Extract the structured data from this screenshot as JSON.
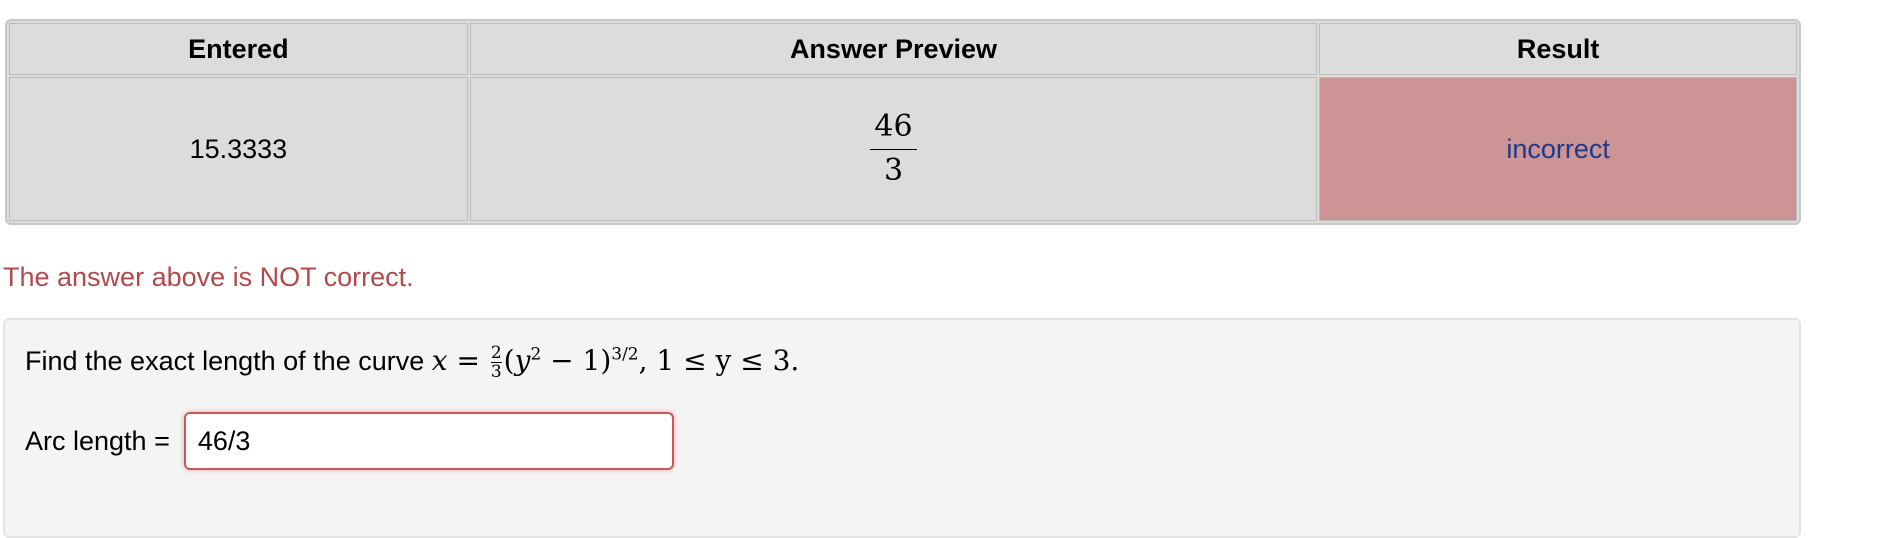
{
  "results_table": {
    "headers": {
      "entered": "Entered",
      "preview": "Answer Preview",
      "result": "Result"
    },
    "row": {
      "entered": "15.3333",
      "preview_numerator": "46",
      "preview_denominator": "3",
      "result": "incorrect"
    },
    "colors": {
      "header_bg": "#dcdcdc",
      "incorrect_bg": "#cc9494",
      "incorrect_text": "#1c3a8c"
    }
  },
  "feedback": {
    "message": "The answer above is NOT correct.",
    "color": "#b14a4a"
  },
  "problem": {
    "intro": "Find the exact length of the curve",
    "equation": {
      "lhs": "x",
      "equals": "=",
      "coef_num": "2",
      "coef_den": "3",
      "open": "(",
      "base": "y",
      "base_exp": "2",
      "minus_one": " − 1)",
      "outer_exp": "3/2",
      "domain": ", 1 ≤ y ≤ 3."
    },
    "answer_label": "Arc length =",
    "answer_value": "46/3"
  }
}
